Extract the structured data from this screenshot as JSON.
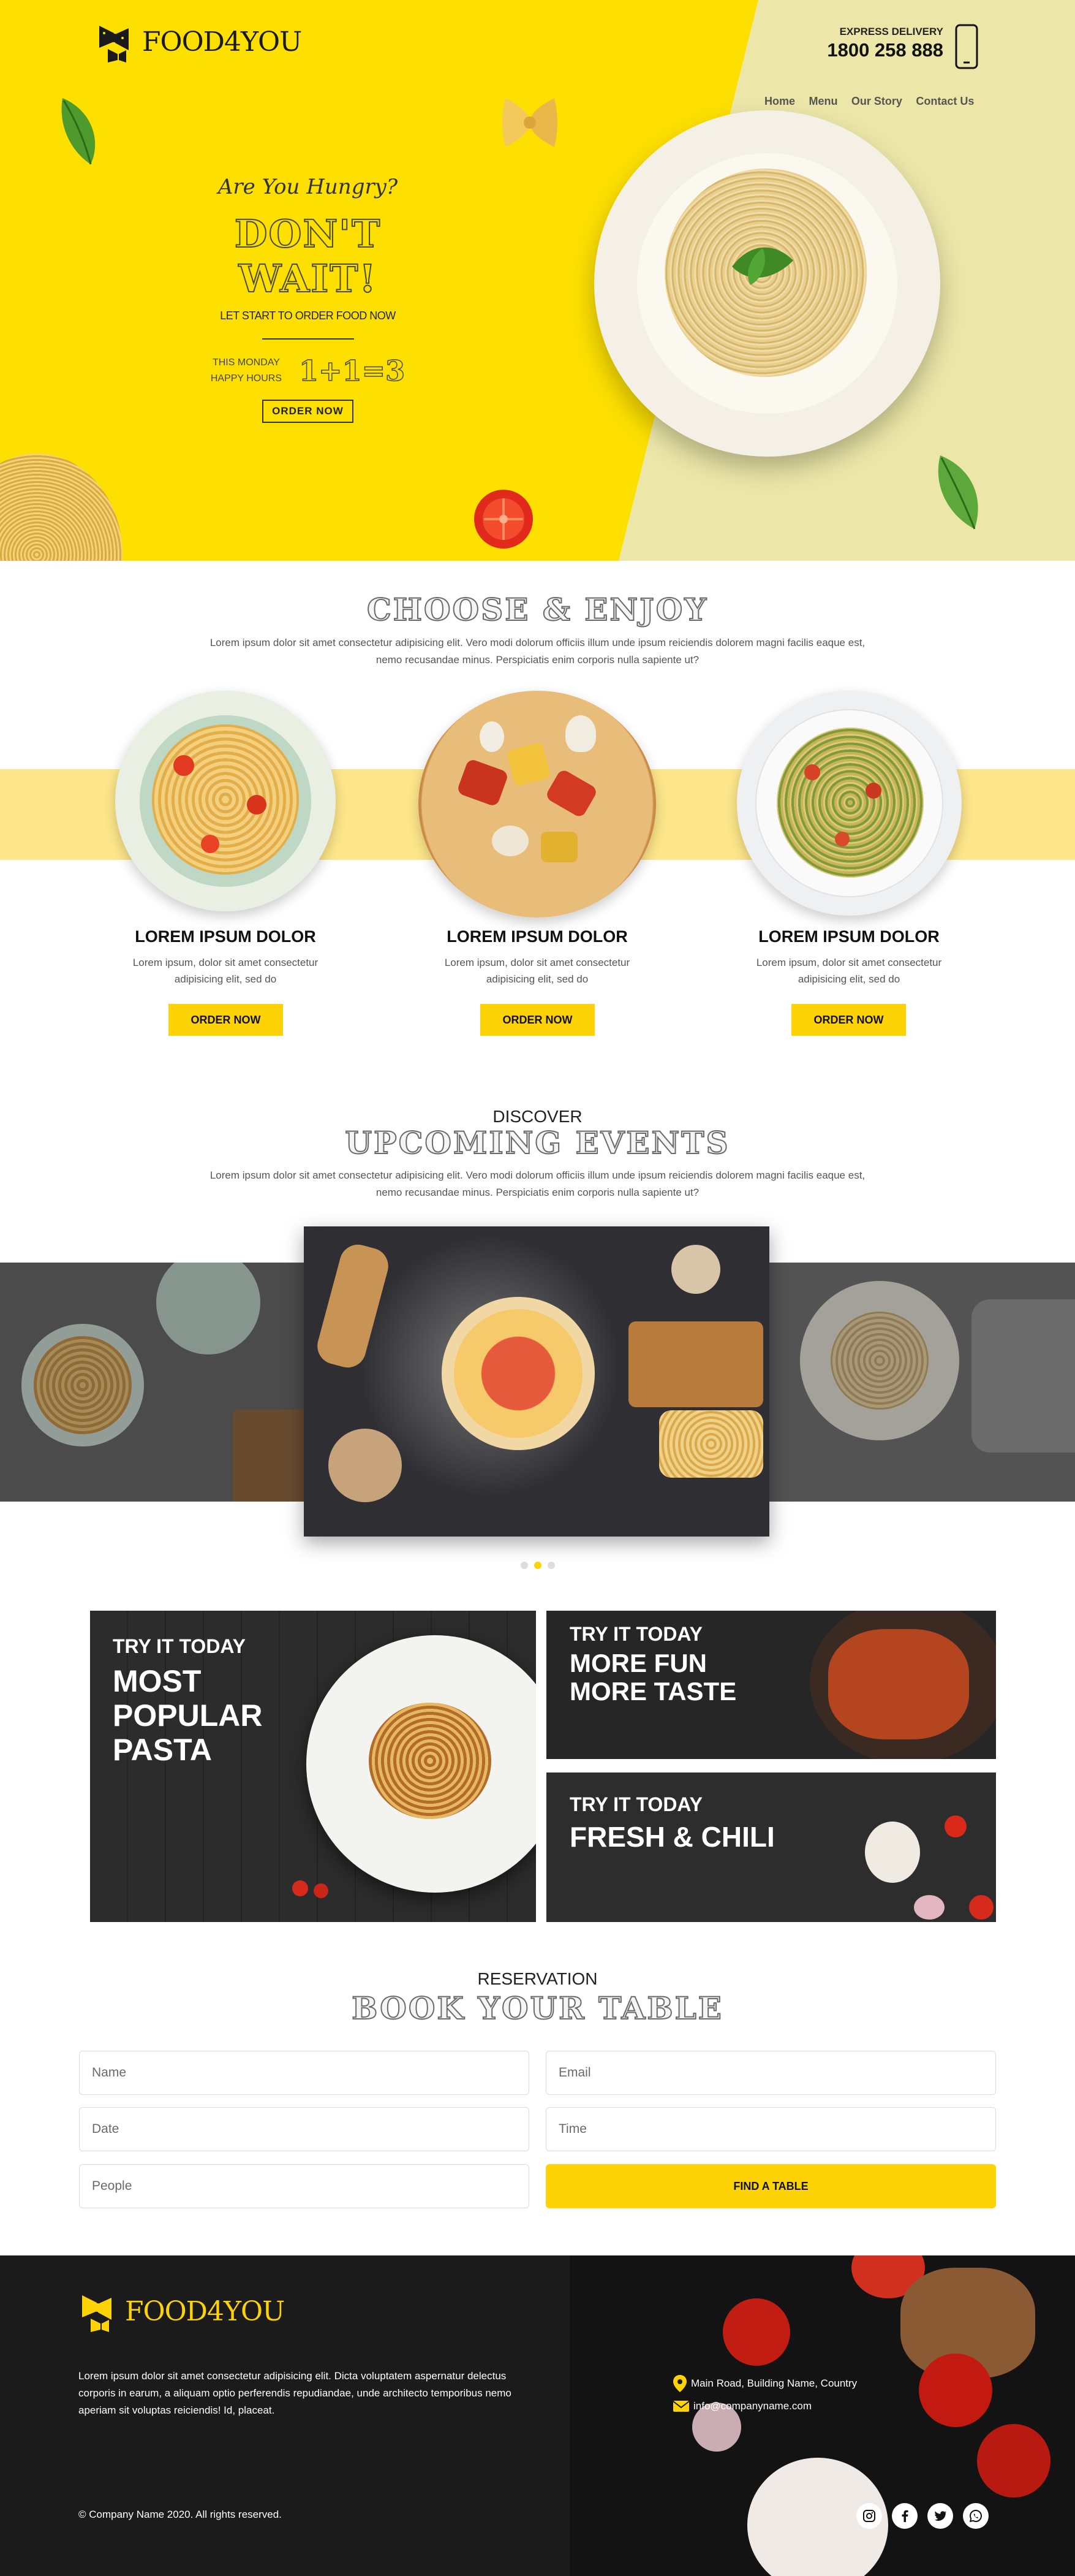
{
  "brand": {
    "name": "FOOD4YOU"
  },
  "header": {
    "delivery_label": "EXPRESS DELIVERY",
    "phone": "1800 258 888",
    "nav": [
      "Home",
      "Menu",
      "Our Story",
      "Contact Us"
    ]
  },
  "hero": {
    "kicker": "Are You Hungry?",
    "headline": "DON'T WAIT!",
    "subline": "LET START TO ORDER FOOD NOW",
    "promo_day": "THIS MONDAY",
    "promo_hours": "HAPPY HOURS",
    "promo_offer": "1+1=3",
    "cta": "ORDER NOW"
  },
  "choose": {
    "title": "CHOOSE & ENJOY",
    "text": "Lorem ipsum dolor sit amet consectetur adipisicing elit. Vero modi dolorum officiis illum unde ipsum reiciendis dolorem magni facilis eaque est, nemo recusandae minus. Perspiciatis enim corporis nulla sapiente ut?",
    "cards": [
      {
        "title": "LOREM IPSUM DOLOR",
        "text": "Lorem ipsum, dolor sit amet consectetur adipisicing elit, sed do",
        "button": "ORDER NOW"
      },
      {
        "title": "LOREM IPSUM DOLOR",
        "text": "Lorem ipsum, dolor sit amet consectetur adipisicing elit, sed do",
        "button": "ORDER NOW"
      },
      {
        "title": "LOREM IPSUM DOLOR",
        "text": "Lorem ipsum, dolor sit amet consectetur adipisicing elit, sed do",
        "button": "ORDER NOW"
      }
    ]
  },
  "events": {
    "kicker": "DISCOVER",
    "title": "UPCOMING EVENTS",
    "text": "Lorem ipsum dolor sit amet consectetur adipisicing elit. Vero modi dolorum officiis illum unde ipsum reiciendis dolorem magni facilis eaque est, nemo recusandae minus. Perspiciatis enim corporis nulla sapiente ut?",
    "active_slide": 2,
    "slide_count": 3
  },
  "promos": [
    {
      "small": "TRY IT TODAY",
      "big": "MOST POPULAR PASTA"
    },
    {
      "small": "TRY IT TODAY",
      "big": "MORE FUN MORE TASTE"
    },
    {
      "small": "TRY IT TODAY",
      "big": "FRESH & CHILI"
    }
  ],
  "reservation": {
    "kicker": "RESERVATION",
    "title": "BOOK YOUR TABLE",
    "name_placeholder": "Name",
    "email_placeholder": "Email",
    "date_placeholder": "Date",
    "time_placeholder": "Time",
    "people_placeholder": "People",
    "submit": "FIND A TABLE"
  },
  "footer": {
    "about": "Lorem ipsum dolor sit amet consectetur adipisicing elit. Dicta voluptatem aspernatur delectus corporis in earum, a aliquam optio perferendis repudiandae, unde architecto temporibus nemo aperiam sit voluptas reiciendis! Id, placeat.",
    "address": "Main Road, Building Name, Country",
    "email": "info@companyname.com",
    "copyright": "© Company Name 2020. All rights reserved."
  },
  "colors": {
    "brand_yellow": "#fde000",
    "button_yellow": "#fdd305",
    "pale_yellow": "#ece7a8",
    "dark": "#1b1b1b"
  },
  "icons": [
    "bowtie-pasta-logo-icon",
    "phone-icon",
    "map-pin-icon",
    "mail-icon",
    "instagram-icon",
    "facebook-icon",
    "twitter-icon",
    "whatsapp-icon"
  ]
}
